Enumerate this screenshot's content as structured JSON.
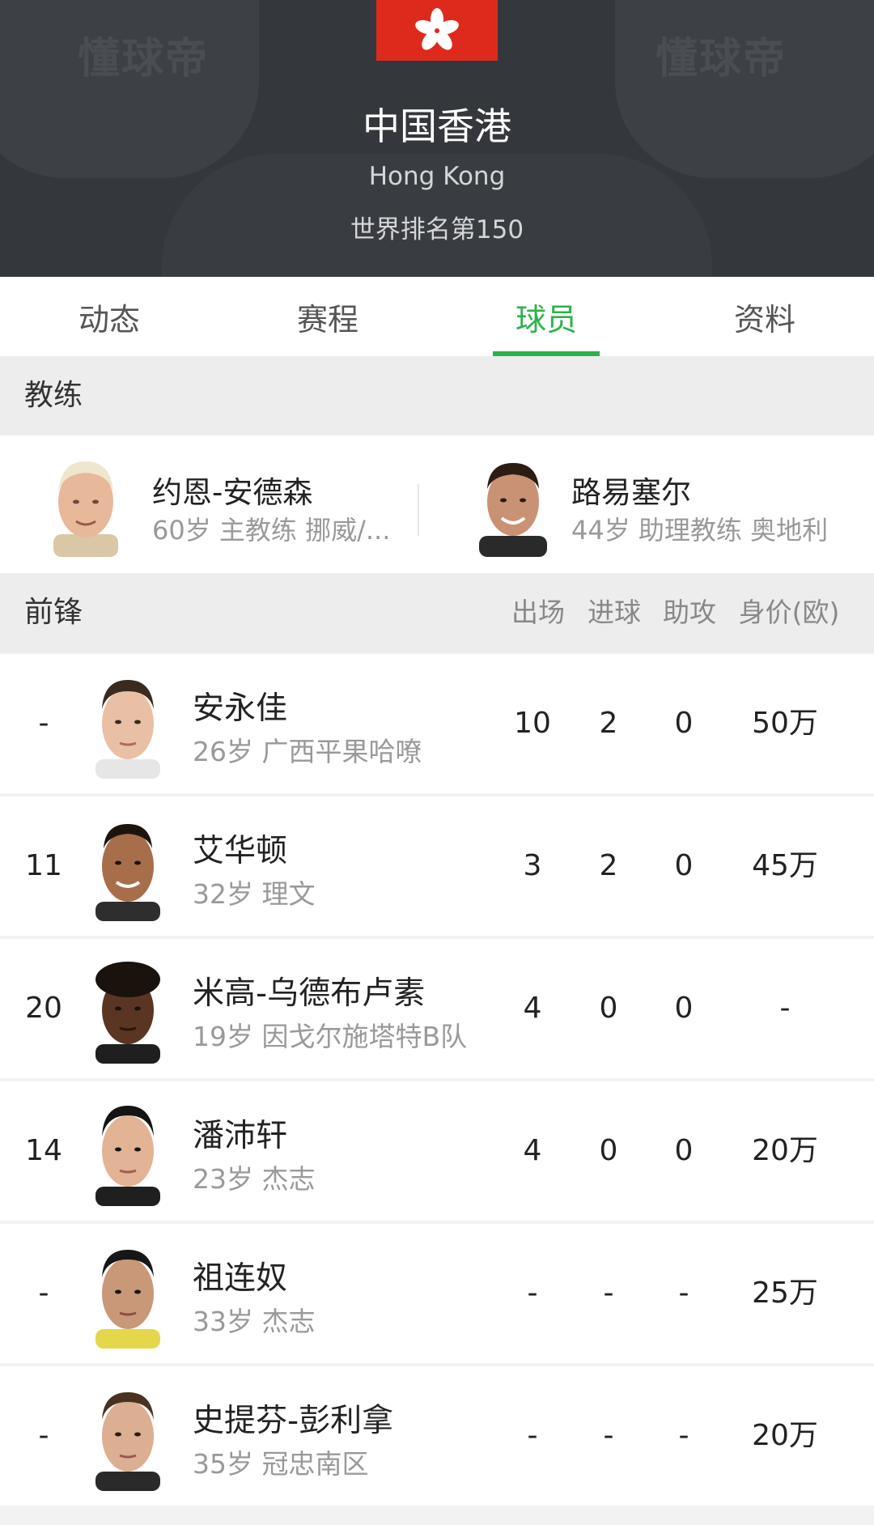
{
  "header": {
    "watermark_left": "懂球帝",
    "watermark_right": "懂球帝",
    "team_name": "中国香港",
    "team_name_en": "Hong Kong",
    "ranking": "世界排名第150",
    "flag_color": "#de2a1d"
  },
  "tabs": [
    {
      "label": "动态",
      "active": false
    },
    {
      "label": "赛程",
      "active": false
    },
    {
      "label": "球员",
      "active": true
    },
    {
      "label": "资料",
      "active": false
    }
  ],
  "accent_color": "#2db24a",
  "coach_section": {
    "title": "教练",
    "coaches": [
      {
        "name": "约恩-安德森",
        "info": "60岁 主教练 挪威/..."
      },
      {
        "name": "路易塞尔",
        "info": "44岁 助理教练 奥地利"
      }
    ]
  },
  "forward_section": {
    "title": "前锋",
    "columns": [
      "出场",
      "进球",
      "助攻",
      "身价(欧)"
    ],
    "players": [
      {
        "number": "-",
        "name": "安永佳",
        "info": "26岁 广西平果哈嘹",
        "apps": "10",
        "goals": "2",
        "assists": "0",
        "value": "50万"
      },
      {
        "number": "11",
        "name": "艾华顿",
        "info": "32岁 理文",
        "apps": "3",
        "goals": "2",
        "assists": "0",
        "value": "45万"
      },
      {
        "number": "20",
        "name": "米高-乌德布卢素",
        "info": "19岁 因戈尔施塔特B队",
        "apps": "4",
        "goals": "0",
        "assists": "0",
        "value": "-"
      },
      {
        "number": "14",
        "name": "潘沛轩",
        "info": "23岁 杰志",
        "apps": "4",
        "goals": "0",
        "assists": "0",
        "value": "20万"
      },
      {
        "number": "-",
        "name": "祖连奴",
        "info": "33岁 杰志",
        "apps": "-",
        "goals": "-",
        "assists": "-",
        "value": "25万"
      },
      {
        "number": "-",
        "name": "史提芬-彭利拿",
        "info": "35岁 冠忠南区",
        "apps": "-",
        "goals": "-",
        "assists": "-",
        "value": "20万"
      }
    ]
  }
}
